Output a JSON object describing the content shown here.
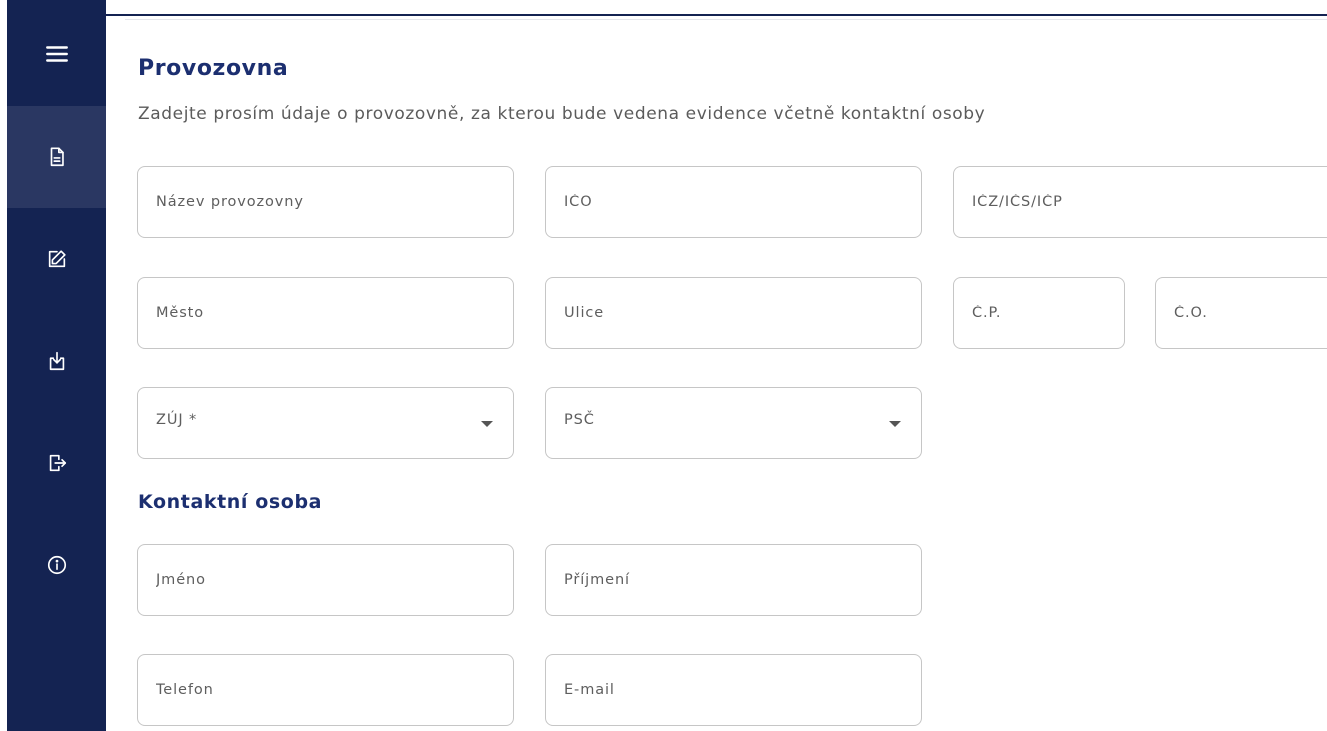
{
  "sidebar": {
    "items": [
      {
        "icon": "document-icon",
        "active": true
      },
      {
        "icon": "edit-icon",
        "active": false
      },
      {
        "icon": "download-icon",
        "active": false
      },
      {
        "icon": "logout-icon",
        "active": false
      },
      {
        "icon": "info-icon",
        "active": false
      }
    ],
    "menu_icon": "hamburger-icon"
  },
  "colors": {
    "sidebar_bg": "#142352",
    "sidebar_active": "#2a3762",
    "heading": "#1c2f70",
    "border": "#c6c6c6"
  },
  "provozovna": {
    "title": "Provozovna",
    "subtitle": "Zadejte prosím údaje o provozovně, za kterou bude vedena evidence včetně kontaktní osoby",
    "fields": {
      "nazev": "Název provozovny",
      "ico": "IČO",
      "icz": "IČZ/IČS/IČP",
      "mesto": "Město",
      "ulice": "Ulice",
      "cp": "Č.P.",
      "co": "Č.O.",
      "zuj": "ZÚJ *",
      "psc": "PSČ"
    }
  },
  "kontakt": {
    "title": "Kontaktní osoba",
    "fields": {
      "jmeno": "Jméno",
      "prijmeni": "Příjmení",
      "telefon": "Telefon",
      "email": "E-mail"
    }
  }
}
